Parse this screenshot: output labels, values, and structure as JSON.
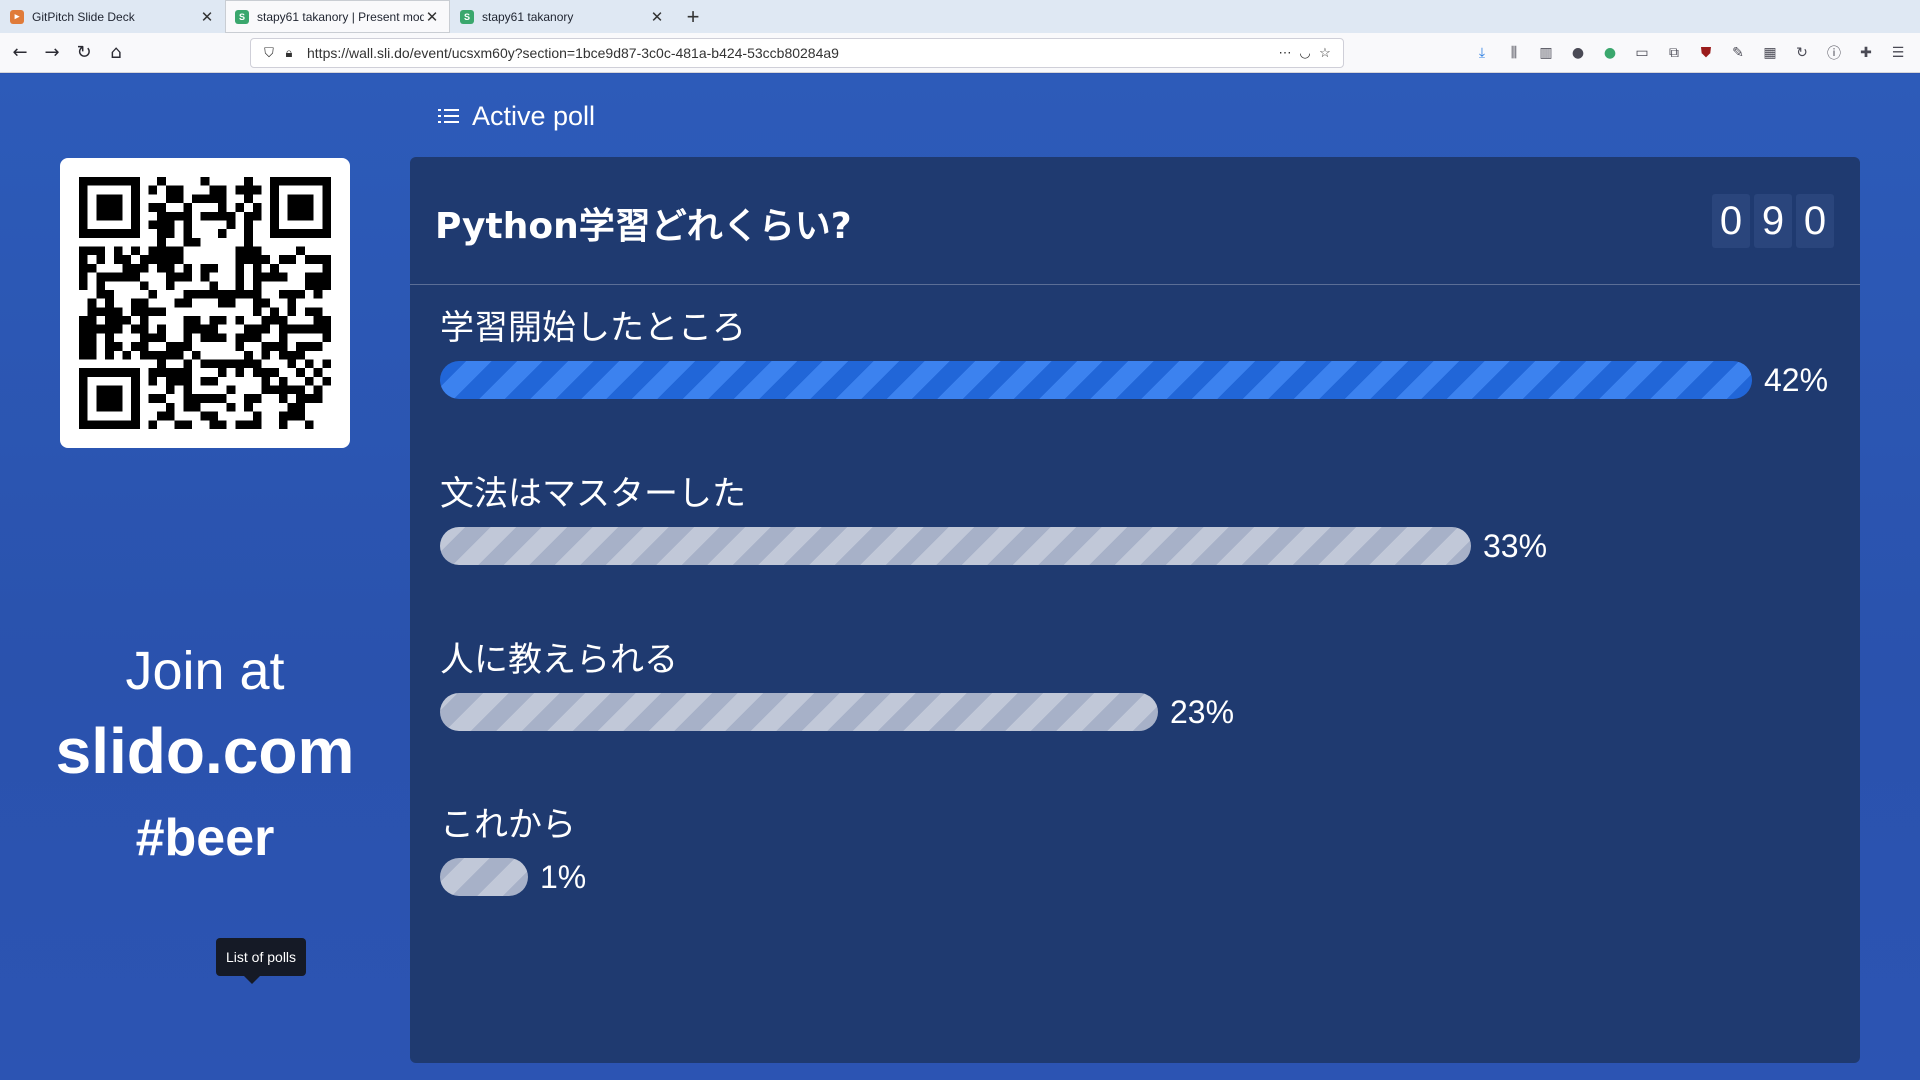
{
  "browser": {
    "tabs": [
      {
        "label": "GitPitch Slide Deck",
        "favicon_color": "#e07b39",
        "active": false
      },
      {
        "label": "stapy61 takanory | Present mode",
        "favicon_color": "#3aa76d",
        "active": true
      },
      {
        "label": "stapy61 takanory",
        "favicon_color": "#3aa76d",
        "active": false
      }
    ],
    "url": "https://wall.sli.do/event/ucsxm60y?section=1bce9d87-3c0c-481a-b424-53ccb80284a9"
  },
  "header": {
    "title": "Active poll"
  },
  "join": {
    "prefix": "Join at",
    "site": "slido.com",
    "code": "#beer"
  },
  "tooltip": "List of polls",
  "poll": {
    "question": "Python学習どれくらい?",
    "counter_digits": [
      "0",
      "9",
      "0"
    ]
  },
  "chart_data": {
    "type": "bar",
    "categories": [
      "学習開始したところ",
      "文法はマスターした",
      "人に教えられる",
      "これから"
    ],
    "values": [
      42,
      33,
      23,
      1
    ],
    "labels": [
      "42%",
      "33%",
      "23%",
      "1%"
    ]
  },
  "colors": {
    "page_bg": "#2b55b3",
    "panel_bg": "#1f3a70",
    "top_bar": "#2f74e6",
    "other_bar": "#b4bdd0"
  }
}
